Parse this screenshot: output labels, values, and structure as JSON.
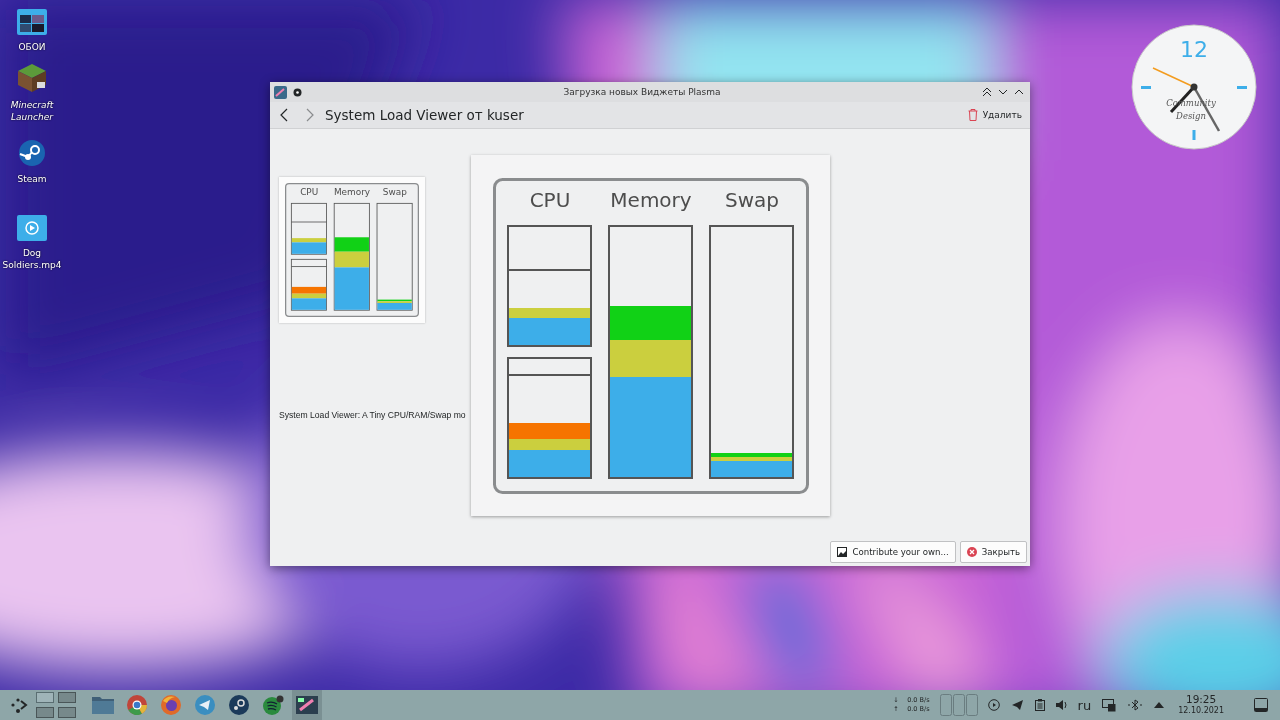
{
  "desktop_icons": [
    {
      "label": "ОБОИ",
      "kind": "folder",
      "italic": false
    },
    {
      "label": "Minecraft Launcher",
      "kind": "minecraft",
      "italic": true
    },
    {
      "label": "Steam",
      "kind": "steam",
      "italic": false
    },
    {
      "label": "Dog Soldiers.mp4",
      "kind": "video",
      "italic": false
    }
  ],
  "clock": {
    "numeral": "12",
    "brand": [
      "Community",
      "Design"
    ]
  },
  "window": {
    "title": "Загрузка новых Виджеты Plasma",
    "heading": "System Load Viewer от kuser",
    "delete_button": "Удалить",
    "thumbnail": {
      "labels": [
        "CPU",
        "Memory",
        "Swap"
      ]
    },
    "description": "System Load Viewer: A Tiny CPU/RAM/Swap mo",
    "preview": {
      "labels": [
        "CPU",
        "Memory",
        "Swap"
      ]
    },
    "buttons": [
      {
        "label": "Contribute your own...",
        "kind": "contribute"
      },
      {
        "label": "Закрыть",
        "kind": "close"
      }
    ]
  },
  "taskbar": {
    "pager": [
      {
        "selected": true
      },
      {
        "selected": false
      },
      {
        "selected": false
      },
      {
        "selected": false
      }
    ],
    "apps": [
      {
        "kind": "files",
        "selected": false
      },
      {
        "kind": "chrome",
        "selected": false
      },
      {
        "kind": "firefox",
        "selected": false
      },
      {
        "kind": "telegram",
        "selected": false
      },
      {
        "kind": "steam",
        "selected": false
      },
      {
        "kind": "spotify",
        "selected": false
      },
      {
        "kind": "plasma",
        "selected": true
      }
    ],
    "network": {
      "down": "↓",
      "down_rate": "0.0 B/s",
      "up": "↑",
      "up_rate": "0.0 B/s"
    },
    "language": "ru",
    "time": "19:25",
    "date": "12.10.2021"
  }
}
